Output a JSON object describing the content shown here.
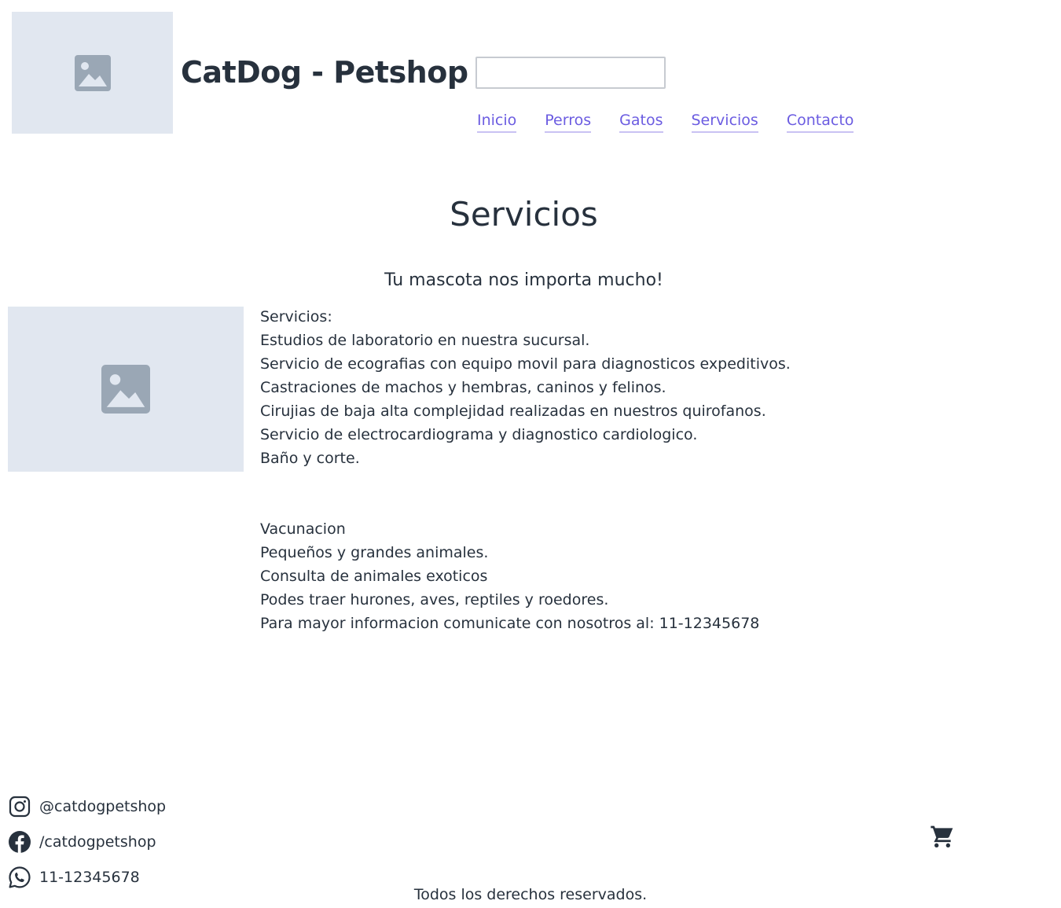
{
  "header": {
    "title": "CatDog - Petshop",
    "search_value": "",
    "nav": [
      "Inicio",
      "Perros",
      "Gatos",
      "Servicios",
      "Contacto"
    ]
  },
  "main": {
    "heading": "Servicios",
    "tagline": "Tu mascota nos importa mucho!",
    "services": [
      "Servicios:",
      "Estudios de laboratorio en nuestra sucursal.",
      "Servicio de ecografias con equipo movil para diagnosticos expeditivos.",
      "Castraciones de machos y hembras, caninos y felinos.",
      "Cirujias de baja alta complejidad realizadas en nuestros quirofanos.",
      "Servicio de electrocardiograma y diagnostico cardiologico.",
      "Baño y corte.",
      "",
      "Vacunacion",
      "Pequeños y grandes animales.",
      "Consulta de animales exoticos",
      "Podes traer hurones, aves, reptiles y roedores.",
      "Para mayor informacion comunicate con nosotros al: 11-12345678"
    ]
  },
  "footer": {
    "social": [
      {
        "icon": "instagram-icon",
        "label": "@catdogpetshop"
      },
      {
        "icon": "facebook-icon",
        "label": "/catdogpetshop"
      },
      {
        "icon": "whatsapp-icon",
        "label": "11-12345678"
      }
    ],
    "copyright": "Todos los derechos reservados."
  },
  "colors": {
    "text": "#27313d",
    "link": "#6b5ce1",
    "link_underline": "#c9c2f3",
    "placeholder_bg": "#e1e7f0",
    "placeholder_icon": "#9aa7b5"
  }
}
